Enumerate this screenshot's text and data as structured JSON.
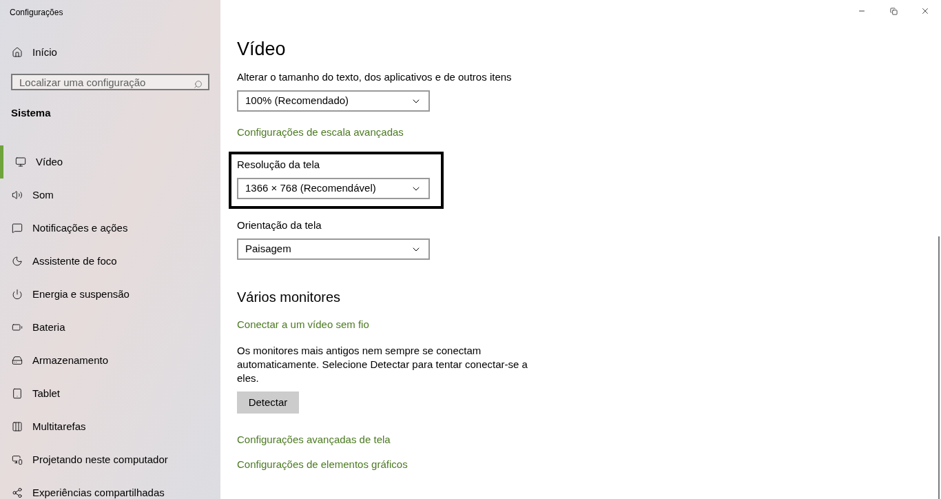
{
  "window": {
    "title": "Configurações"
  },
  "sidebar": {
    "home": "Início",
    "search": {
      "placeholder": "Localizar uma configuração"
    },
    "section": "Sistema",
    "items": [
      {
        "label": "Vídeo",
        "selected": true
      },
      {
        "label": "Som",
        "selected": false
      },
      {
        "label": "Notificações e ações",
        "selected": false
      },
      {
        "label": "Assistente de foco",
        "selected": false
      },
      {
        "label": "Energia e suspensão",
        "selected": false
      },
      {
        "label": "Bateria",
        "selected": false
      },
      {
        "label": "Armazenamento",
        "selected": false
      },
      {
        "label": "Tablet",
        "selected": false
      },
      {
        "label": "Multitarefas",
        "selected": false
      },
      {
        "label": "Projetando neste computador",
        "selected": false
      },
      {
        "label": "Experiências compartilhadas",
        "selected": false
      }
    ]
  },
  "main": {
    "title": "Vídeo",
    "blocks": [
      {
        "kind": "dropdown",
        "label": "Alterar o tamanho do texto, dos aplicativos e de outros itens",
        "value": "100% (Recomendado)",
        "highlighted": false
      },
      {
        "kind": "link",
        "text": "Configurações de escala avançadas"
      },
      {
        "kind": "dropdown",
        "label": "Resolução da tela",
        "value": "1366 × 768 (Recomendável)",
        "highlighted": true
      },
      {
        "kind": "dropdown",
        "label": "Orientação da tela",
        "value": "Paisagem",
        "highlighted": false
      },
      {
        "kind": "heading",
        "text": "Vários monitores"
      },
      {
        "kind": "link",
        "text": "Conectar a um vídeo sem fio"
      },
      {
        "kind": "paragraph",
        "text": "Os monitores mais antigos nem sempre se conectam automaticamente. Selecione Detectar para tentar conectar-se a eles."
      },
      {
        "kind": "button",
        "text": "Detectar"
      },
      {
        "kind": "link",
        "text": "Configurações avançadas de tela"
      },
      {
        "kind": "link",
        "text": "Configurações de elementos gráficos"
      }
    ]
  }
}
